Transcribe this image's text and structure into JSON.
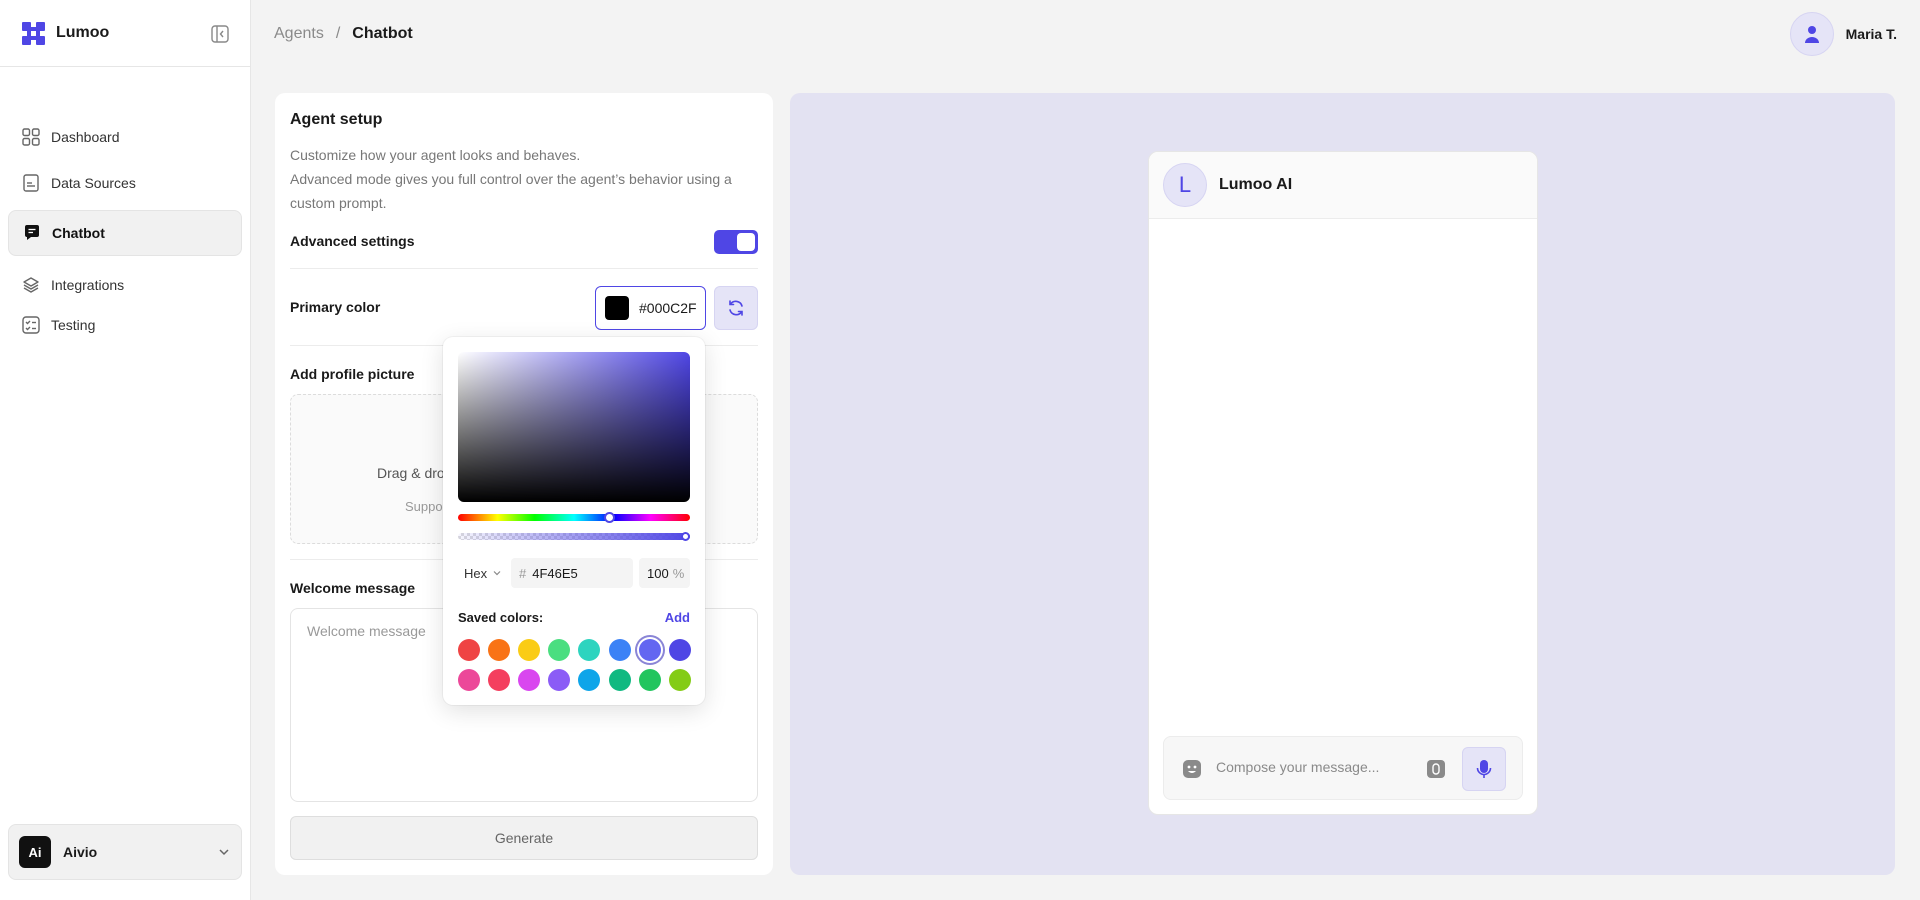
{
  "app": {
    "name": "Lumoo"
  },
  "sidebar": {
    "items": [
      {
        "label": "Dashboard",
        "icon": "grid-icon"
      },
      {
        "label": "Data Sources",
        "icon": "document-icon"
      },
      {
        "label": "Chatbot",
        "icon": "chat-icon",
        "active": true
      },
      {
        "label": "Integrations",
        "icon": "layers-icon"
      },
      {
        "label": "Testing",
        "icon": "checklist-icon"
      }
    ],
    "workspace": {
      "badge": "Ai",
      "name": "Aivio"
    }
  },
  "header": {
    "breadcrumb": [
      "Agents",
      "/",
      "Chatbot"
    ],
    "user_name": "Maria T."
  },
  "setup": {
    "title": "Agent setup",
    "description_line1": "Customize how your agent looks and behaves.",
    "description_line2": "Advanced mode gives you full control over the agent’s behavior using a custom prompt.",
    "advanced_label": "Advanced settings",
    "advanced_on": true,
    "primary_color_label": "Primary color",
    "primary_color_value": "#000C2F",
    "profile_picture_label": "Add profile picture",
    "dropzone_text": "Drag & dro",
    "dropzone_sub": "Suppo",
    "welcome_label": "Welcome message",
    "welcome_placeholder": "Welcome message",
    "generate_label": "Generate"
  },
  "picker": {
    "format": "Hex",
    "hex_prefix": "#",
    "hex_value": "4F46E5",
    "alpha_value": "100",
    "alpha_unit": "%",
    "hue_level": 0.66,
    "alpha_level": 1.0,
    "saved_label": "Saved colors:",
    "add_label": "Add",
    "saved_colors": [
      [
        "#ef4444",
        "#f97316",
        "#facc15",
        "#4ade80",
        "#2dd4bf",
        "#3b82f6",
        "#6366f1",
        "#4f46e5"
      ],
      [
        "#ec4899",
        "#f43f5e",
        "#d946ef",
        "#8b5cf6",
        "#0ea5e9",
        "#10b981",
        "#22c55e",
        "#84cc16"
      ]
    ],
    "selected_index": 6
  },
  "preview": {
    "agent_initial": "L",
    "agent_name": "Lumoo AI",
    "composer_placeholder": "Compose your message..."
  },
  "colors": {
    "accent": "#4F46E5",
    "preview_bg": "#E3E2F2"
  }
}
